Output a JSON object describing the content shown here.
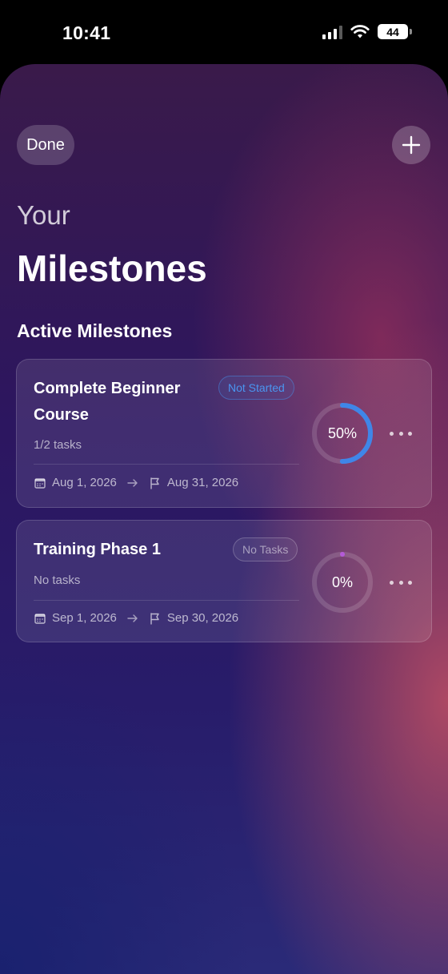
{
  "status_bar": {
    "time": "10:41",
    "battery": "44"
  },
  "header": {
    "done_label": "Done"
  },
  "title": {
    "line1": "Your",
    "line2": "Milestones"
  },
  "section_title": "Active Milestones",
  "milestones": [
    {
      "title": "Complete Beginner Course",
      "status": "Not Started",
      "subtitle": "1/2 tasks",
      "start_date": "Aug 1, 2026",
      "end_date": "Aug 31, 2026",
      "progress_label": "50%",
      "progress": 0.5,
      "ring_color": "#3f86e8"
    },
    {
      "title": "Training Phase 1",
      "status": "No Tasks",
      "subtitle": "No tasks",
      "start_date": "Sep 1, 2026",
      "end_date": "Sep 30, 2026",
      "progress_label": "0%",
      "progress": 0,
      "ring_color": "#b45ad8"
    }
  ],
  "icons": {
    "add": "plus-icon",
    "calendar": "calendar-icon",
    "arrow": "arrow-right-icon",
    "flag": "flag-icon",
    "more": "ellipsis-icon"
  }
}
